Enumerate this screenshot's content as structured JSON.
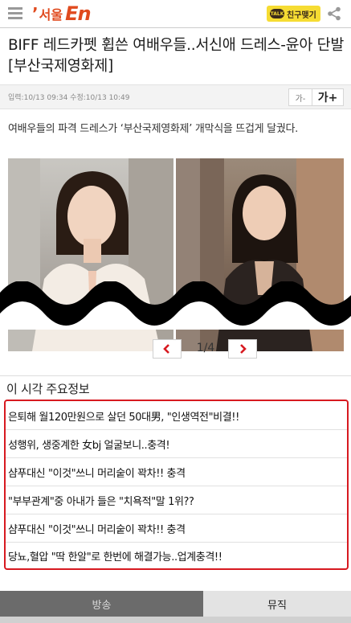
{
  "header": {
    "logo_prefix": "’",
    "logo_word": "서울",
    "logo_brand": "En",
    "kakao_label": "친구맺기",
    "kakao_mark": "TALK"
  },
  "article": {
    "title": "BIFF 레드카펫 휩쓴 여배우들..서신애 드레스-윤아 단발 [부산국제영화제]",
    "dates": "입력:10/13 09:34 수정:10/13 10:49",
    "font_down": "가-",
    "font_up": "가+",
    "lead": "여배우들의 파격 드레스가 ‘부산국제영화제’ 개막식을 뜨겁게 달궜다."
  },
  "pager": {
    "current": "1/4"
  },
  "now_info": {
    "heading": "이 시각 주요정보",
    "items": [
      "은퇴해 월120만원으로 살던 50대男, \"인생역전\"비결!!",
      "성행위, 생중계한 女bj 얼굴보니..충격!",
      "샴푸대신 \"이것\"쓰니 머리숱이 꽉차!! 충격",
      "\"부부관계\"중 아내가 들은 \"치욕적\"말 1위??",
      "샴푸대신 \"이것\"쓰니 머리숱이 꽉차!! 충격",
      "당뇨,혈압 \"딱 한알\"로 한번에 해결가능..업계충격!!"
    ]
  },
  "tabs": {
    "broadcast": "방송",
    "music": "뮤직"
  },
  "colors": {
    "brand": "#e04a1e",
    "accent_red": "#d71920",
    "kakao": "#f6dc33"
  }
}
